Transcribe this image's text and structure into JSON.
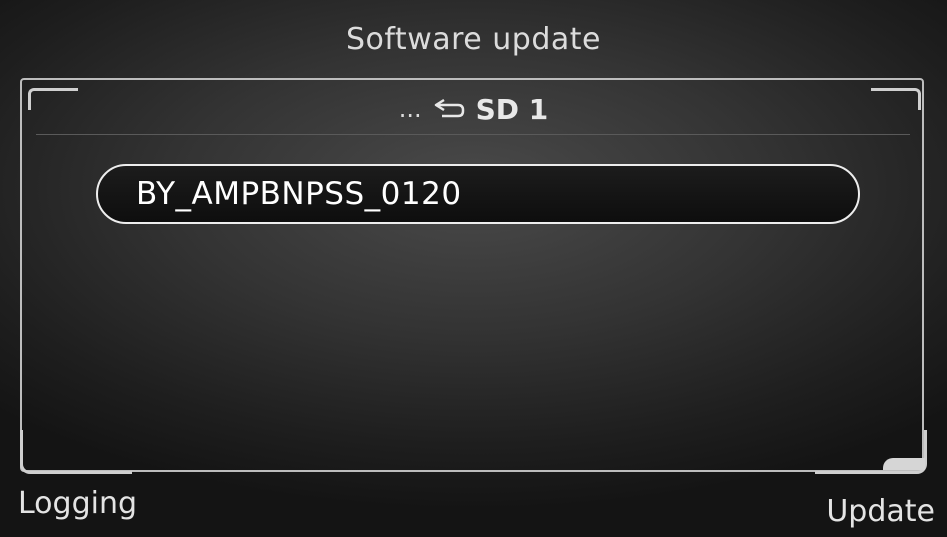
{
  "screen": {
    "title": "Software update"
  },
  "path_bar": {
    "parent_indicator": "...",
    "back_icon": "return-arrow-icon",
    "current_folder": "SD 1"
  },
  "file_list": {
    "items": [
      {
        "label": "BY_AMPBNPSS_0120",
        "selected": true
      }
    ]
  },
  "softkeys": {
    "left_label": "Logging",
    "right_label": "Update"
  },
  "colors": {
    "text": "#e6e6e6",
    "highlight_border": "#ededed",
    "frame": "#bdbdbd"
  }
}
